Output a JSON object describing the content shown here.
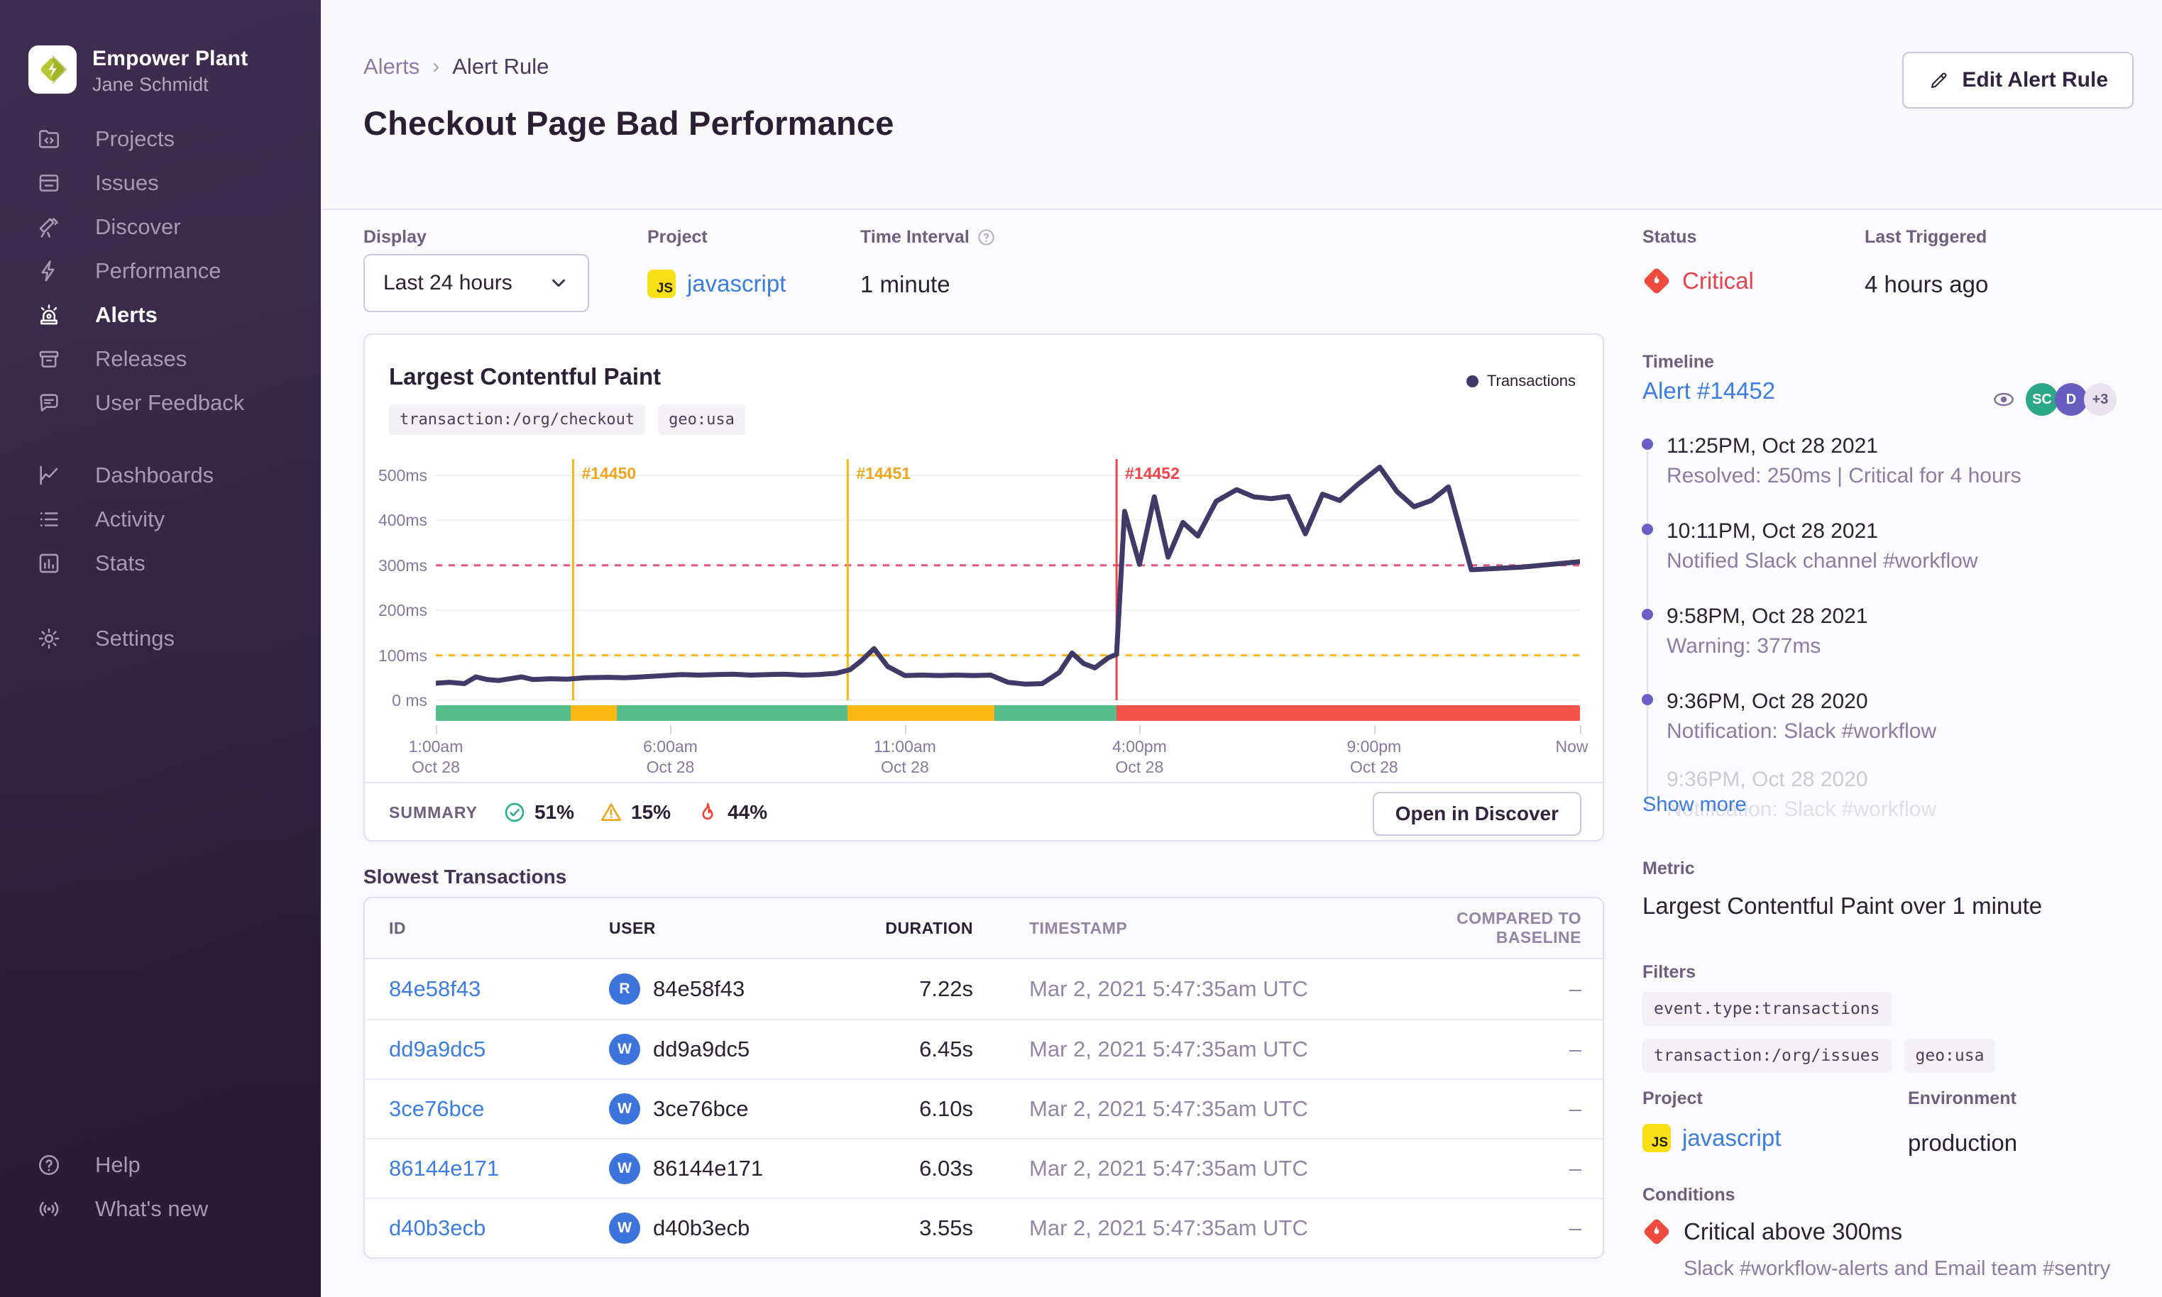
{
  "colors": {
    "accent_blue": "#3b7de0",
    "critical_red": "#e5434f",
    "warning_yellow": "#fcb713",
    "success_green": "#57be8b",
    "strip_red": "#f55349",
    "series_navy": "#3f3a68",
    "sidebar_purple": "#3d2b4e",
    "timeline_dot_purple": "#6c5fc7"
  },
  "sidebar": {
    "org_name": "Empower Plant",
    "user_name": "Jane Schmidt",
    "nav_primary": [
      {
        "label": "Projects",
        "icon": "projects-icon"
      },
      {
        "label": "Issues",
        "icon": "issues-icon"
      },
      {
        "label": "Discover",
        "icon": "discover-icon"
      },
      {
        "label": "Performance",
        "icon": "performance-icon"
      },
      {
        "label": "Alerts",
        "icon": "alerts-icon",
        "active": true
      },
      {
        "label": "Releases",
        "icon": "releases-icon"
      },
      {
        "label": "User Feedback",
        "icon": "user-feedback-icon"
      }
    ],
    "nav_secondary": [
      {
        "label": "Dashboards",
        "icon": "dashboards-icon"
      },
      {
        "label": "Activity",
        "icon": "activity-icon"
      },
      {
        "label": "Stats",
        "icon": "stats-icon"
      }
    ],
    "nav_tertiary": [
      {
        "label": "Settings",
        "icon": "settings-icon"
      }
    ],
    "nav_footer": [
      {
        "label": "Help",
        "icon": "help-icon"
      },
      {
        "label": "What's new",
        "icon": "whats-new-icon"
      }
    ]
  },
  "header": {
    "breadcrumb_parent": "Alerts",
    "breadcrumb_current": "Alert Rule",
    "title": "Checkout Page Bad Performance",
    "edit_button_label": "Edit Alert Rule"
  },
  "controls": {
    "display_label": "Display",
    "display_value": "Last 24 hours",
    "project_label": "Project",
    "project_value": "javascript",
    "interval_label": "Time Interval",
    "interval_value": "1 minute"
  },
  "status_panel": {
    "status_label": "Status",
    "status_value": "Critical",
    "last_triggered_label": "Last Triggered",
    "last_triggered_value": "4 hours ago"
  },
  "chart_card": {
    "title": "Largest Contentful Paint",
    "tags": [
      "transaction:/org/checkout",
      "geo:usa"
    ],
    "legend_label": "Transactions",
    "summary_label": "SUMMARY",
    "summary_items": [
      {
        "icon": "check-circle-icon",
        "value": "51%",
        "color": "#2bb08f"
      },
      {
        "icon": "warning-triangle-icon",
        "value": "15%",
        "color": "#f0a41c"
      },
      {
        "icon": "fire-icon",
        "value": "44%",
        "color": "#ef4434"
      }
    ],
    "discover_button_label": "Open in Discover"
  },
  "chart_data": {
    "type": "line",
    "title": "Largest Contentful Paint",
    "ylabel": "ms",
    "ylim": [
      0,
      536
    ],
    "y_ticks": [
      {
        "value": 500,
        "label": "500ms"
      },
      {
        "value": 400,
        "label": "400ms"
      },
      {
        "value": 300,
        "label": "300ms"
      },
      {
        "value": 200,
        "label": "200ms"
      },
      {
        "value": 100,
        "label": "100ms"
      },
      {
        "value": 0,
        "label": "0 ms"
      }
    ],
    "x_ticks": [
      {
        "pos": 0.0,
        "line1": "1:00am",
        "line2": "Oct 28"
      },
      {
        "pos": 0.205,
        "line1": "6:00am",
        "line2": "Oct 28"
      },
      {
        "pos": 0.41,
        "line1": "11:00am",
        "line2": "Oct 28"
      },
      {
        "pos": 0.615,
        "line1": "4:00pm",
        "line2": "Oct 28"
      },
      {
        "pos": 0.82,
        "line1": "9:00pm",
        "line2": "Oct 28"
      },
      {
        "pos": 1.0,
        "line1": "Now",
        "line2": ""
      }
    ],
    "thresholds": [
      {
        "value": 300,
        "color": "#e4567c",
        "style": "dashed",
        "name": "critical"
      },
      {
        "value": 100,
        "color": "#fcb713",
        "style": "dashed",
        "name": "warning"
      }
    ],
    "incident_lines": [
      {
        "pos": 0.12,
        "label": "#14450",
        "color": "#f0a41c"
      },
      {
        "pos": 0.36,
        "label": "#14451",
        "color": "#f0a41c"
      },
      {
        "pos": 0.595,
        "label": "#14452",
        "color": "#f04349"
      }
    ],
    "status_strip": [
      {
        "from": 0.0,
        "to": 0.118,
        "color": "#57be8b"
      },
      {
        "from": 0.118,
        "to": 0.158,
        "color": "#fcb713"
      },
      {
        "from": 0.158,
        "to": 0.36,
        "color": "#57be8b"
      },
      {
        "from": 0.36,
        "to": 0.488,
        "color": "#fcb713"
      },
      {
        "from": 0.488,
        "to": 0.595,
        "color": "#57be8b"
      },
      {
        "from": 0.595,
        "to": 1.0,
        "color": "#f55349"
      }
    ],
    "series": [
      {
        "name": "Transactions",
        "unit": "ms",
        "points": [
          [
            0.0,
            38
          ],
          [
            0.012,
            40
          ],
          [
            0.025,
            37
          ],
          [
            0.035,
            52
          ],
          [
            0.045,
            46
          ],
          [
            0.055,
            44
          ],
          [
            0.065,
            48
          ],
          [
            0.075,
            52
          ],
          [
            0.085,
            46
          ],
          [
            0.1,
            48
          ],
          [
            0.115,
            47
          ],
          [
            0.13,
            50
          ],
          [
            0.15,
            51
          ],
          [
            0.165,
            50
          ],
          [
            0.18,
            52
          ],
          [
            0.2,
            55
          ],
          [
            0.215,
            57
          ],
          [
            0.23,
            56
          ],
          [
            0.245,
            57
          ],
          [
            0.26,
            58
          ],
          [
            0.275,
            56
          ],
          [
            0.29,
            57
          ],
          [
            0.305,
            58
          ],
          [
            0.32,
            56
          ],
          [
            0.335,
            57
          ],
          [
            0.35,
            60
          ],
          [
            0.362,
            68
          ],
          [
            0.372,
            88
          ],
          [
            0.383,
            115
          ],
          [
            0.395,
            75
          ],
          [
            0.41,
            55
          ],
          [
            0.425,
            56
          ],
          [
            0.44,
            55
          ],
          [
            0.455,
            56
          ],
          [
            0.47,
            55
          ],
          [
            0.485,
            56
          ],
          [
            0.5,
            40
          ],
          [
            0.515,
            36
          ],
          [
            0.53,
            37
          ],
          [
            0.545,
            62
          ],
          [
            0.556,
            105
          ],
          [
            0.566,
            82
          ],
          [
            0.576,
            72
          ],
          [
            0.588,
            95
          ],
          [
            0.595,
            102
          ],
          [
            0.602,
            420
          ],
          [
            0.615,
            302
          ],
          [
            0.628,
            452
          ],
          [
            0.64,
            318
          ],
          [
            0.653,
            395
          ],
          [
            0.666,
            365
          ],
          [
            0.682,
            442
          ],
          [
            0.7,
            468
          ],
          [
            0.715,
            452
          ],
          [
            0.73,
            448
          ],
          [
            0.745,
            453
          ],
          [
            0.76,
            370
          ],
          [
            0.775,
            458
          ],
          [
            0.79,
            444
          ],
          [
            0.805,
            478
          ],
          [
            0.825,
            518
          ],
          [
            0.84,
            464
          ],
          [
            0.855,
            430
          ],
          [
            0.87,
            444
          ],
          [
            0.885,
            474
          ],
          [
            0.905,
            290
          ],
          [
            0.95,
            296
          ],
          [
            1.0,
            308
          ]
        ]
      }
    ],
    "legend_position": "top-right",
    "grid": true
  },
  "table": {
    "heading": "Slowest Transactions",
    "columns": [
      "ID",
      "USER",
      "DURATION",
      "TIMESTAMP",
      "COMPARED TO BASELINE"
    ],
    "rows": [
      {
        "id": "84e58f43",
        "avatar": "R",
        "user": "84e58f43",
        "duration": "7.22s",
        "timestamp": "Mar 2, 2021 5:47:35am UTC",
        "baseline": "–"
      },
      {
        "id": "dd9a9dc5",
        "avatar": "W",
        "user": "dd9a9dc5",
        "duration": "6.45s",
        "timestamp": "Mar 2, 2021 5:47:35am UTC",
        "baseline": "–"
      },
      {
        "id": "3ce76bce",
        "avatar": "W",
        "user": "3ce76bce",
        "duration": "6.10s",
        "timestamp": "Mar 2, 2021 5:47:35am UTC",
        "baseline": "–"
      },
      {
        "id": "86144e171",
        "avatar": "W",
        "user": "86144e171",
        "duration": "6.03s",
        "timestamp": "Mar 2, 2021 5:47:35am UTC",
        "baseline": "–"
      },
      {
        "id": "d40b3ecb",
        "avatar": "W",
        "user": "d40b3ecb",
        "duration": "3.55s",
        "timestamp": "Mar 2, 2021 5:47:35am UTC",
        "baseline": "–"
      }
    ]
  },
  "timeline": {
    "label": "Timeline",
    "alert_link": "Alert #14452",
    "watchers": [
      {
        "label": "SC",
        "color": "#2ba885",
        "text_color": "#ffffff"
      },
      {
        "label": "D",
        "color": "#6a5dc1",
        "text_color": "#ffffff"
      },
      {
        "label": "+3",
        "color": "#e9e3f1",
        "text_color": "#645478"
      }
    ],
    "events": [
      {
        "time": "11:25PM, Oct 28 2021",
        "description": "Resolved: 250ms | Critical for 4 hours"
      },
      {
        "time": "10:11PM, Oct 28 2021",
        "description": "Notified Slack channel #workflow"
      },
      {
        "time": "9:58PM, Oct 28 2021",
        "description": "Warning: 377ms"
      },
      {
        "time": "9:36PM, Oct 28 2020",
        "description": "Notification: Slack #workflow"
      },
      {
        "time": "9:36PM, Oct 28 2020",
        "description": "Notification: Slack #workflow",
        "faded": true
      }
    ],
    "show_more_label": "Show more"
  },
  "details": {
    "metric_label": "Metric",
    "metric_value": "Largest Contentful Paint over 1 minute",
    "filters_label": "Filters",
    "filters": [
      "event.type:transactions",
      "transaction:/org/issues",
      "geo:usa"
    ],
    "project_label": "Project",
    "project_value": "javascript",
    "environment_label": "Environment",
    "environment_value": "production",
    "conditions_label": "Conditions",
    "condition_title": "Critical above 300ms",
    "condition_description": "Slack #workflow-alerts and Email team #sentry"
  }
}
